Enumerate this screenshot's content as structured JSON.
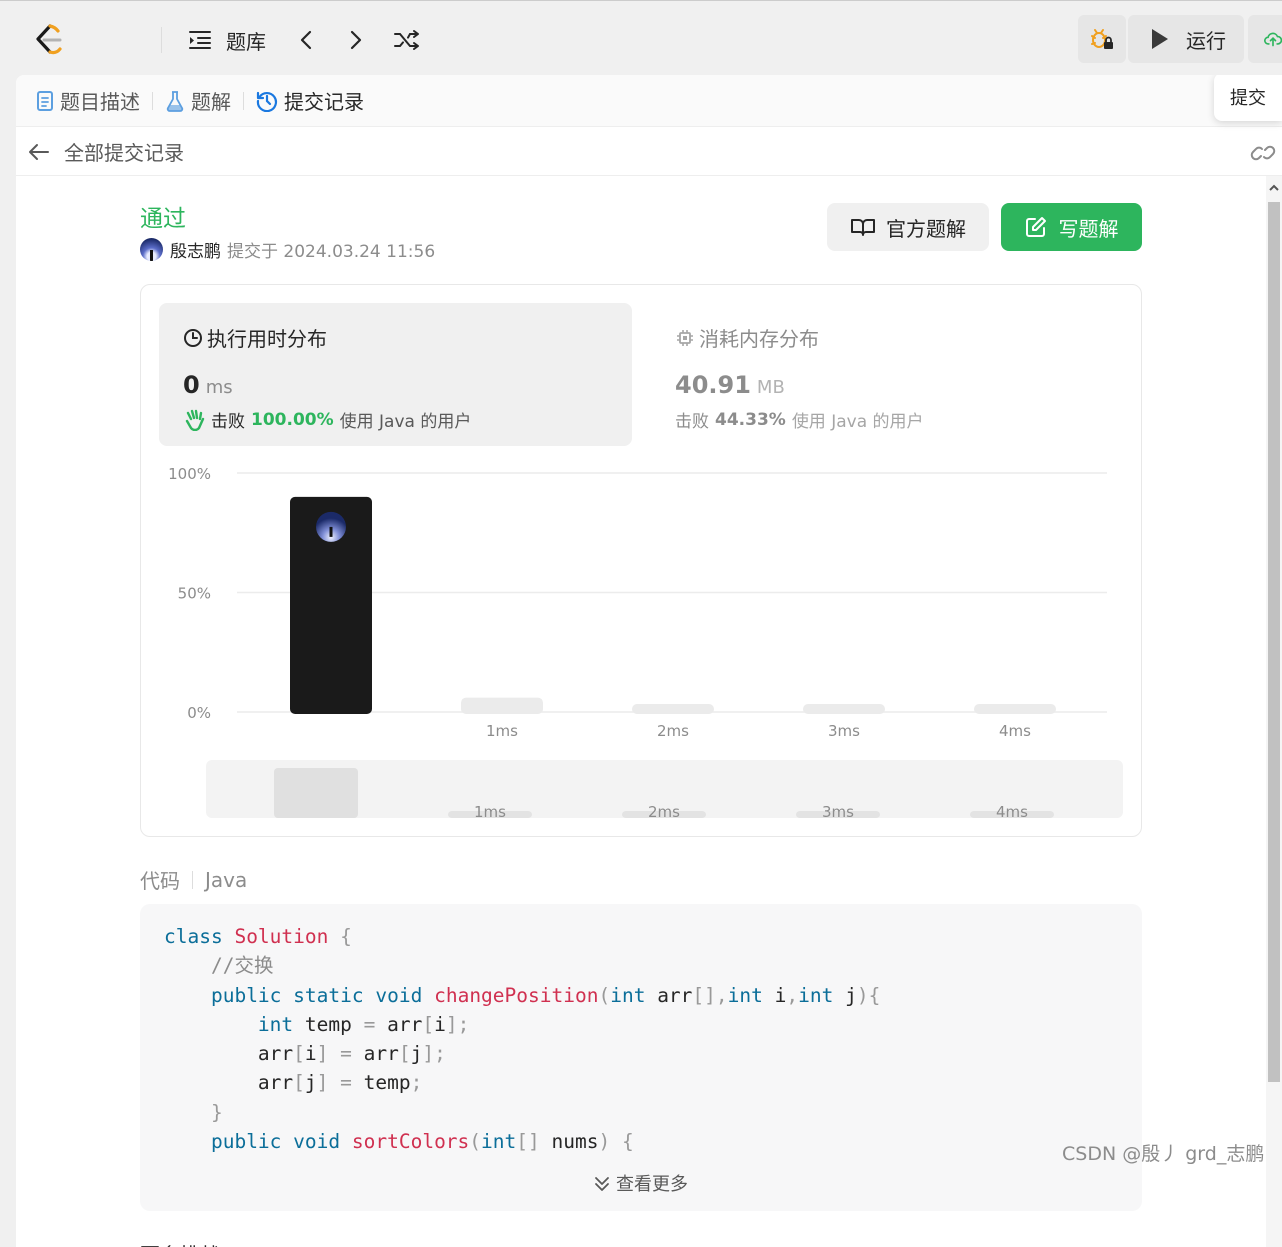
{
  "topbar": {
    "problem_bank_label": "题库",
    "run_label": "运行",
    "submit_label": "提交"
  },
  "tabs": [
    {
      "label": "题目描述",
      "icon": "document-icon",
      "color": "#5c9fe0"
    },
    {
      "label": "题解",
      "icon": "flask-icon",
      "color": "#5c9fe0"
    },
    {
      "label": "提交记录",
      "icon": "history-icon",
      "color": "#1a78e0"
    }
  ],
  "back": {
    "label": "全部提交记录"
  },
  "submission": {
    "status": "通过",
    "author": "殷志鹏",
    "submitted_at": "提交于 2024.03.24 11:56",
    "official_solution_label": "官方题解",
    "write_solution_label": "写题解"
  },
  "runtime": {
    "title": "执行用时分布",
    "value": "0",
    "unit": "ms",
    "beat_prefix": "击败",
    "beat_pct": "100.00%",
    "beat_suffix": "使用 Java 的用户"
  },
  "memory": {
    "title": "消耗内存分布",
    "value": "40.91",
    "unit": "MB",
    "beat_prefix": "击败",
    "beat_pct": "44.33%",
    "beat_suffix": "使用 Java 的用户"
  },
  "chart_data": {
    "type": "bar",
    "categories": [
      "0ms",
      "1ms",
      "2ms",
      "3ms",
      "4ms"
    ],
    "values": [
      90,
      6,
      2,
      2,
      2
    ],
    "tick_labels": [
      "",
      "1ms",
      "2ms",
      "3ms",
      "4ms"
    ],
    "highlight_index": 0,
    "ylim": [
      0,
      100
    ],
    "yticks": [
      "100%",
      "50%",
      "0%"
    ],
    "grid": true,
    "colors": {
      "highlight": "#1a1a1a",
      "bar": "#ebebeb",
      "grid": "#ececec"
    },
    "overview": {
      "values": [
        22,
        3,
        3,
        3,
        3
      ],
      "tick_labels": [
        "",
        "1ms",
        "2ms",
        "3ms",
        "4ms"
      ]
    }
  },
  "code": {
    "label": "代码",
    "language": "Java",
    "lines": [
      [
        {
          "c": "kw",
          "t": "class"
        },
        {
          "c": "",
          "t": " "
        },
        {
          "c": "fn",
          "t": "Solution"
        },
        {
          "c": "",
          "t": " "
        },
        {
          "c": "pu",
          "t": "{"
        }
      ],
      [
        {
          "c": "",
          "t": "    "
        },
        {
          "c": "cm",
          "t": "//交换"
        }
      ],
      [
        {
          "c": "",
          "t": "    "
        },
        {
          "c": "kw",
          "t": "public"
        },
        {
          "c": "",
          "t": " "
        },
        {
          "c": "kw",
          "t": "static"
        },
        {
          "c": "",
          "t": " "
        },
        {
          "c": "kw",
          "t": "void"
        },
        {
          "c": "",
          "t": " "
        },
        {
          "c": "fn",
          "t": "changePosition"
        },
        {
          "c": "pu",
          "t": "("
        },
        {
          "c": "ty",
          "t": "int"
        },
        {
          "c": "",
          "t": " arr"
        },
        {
          "c": "pu",
          "t": "[],"
        },
        {
          "c": "ty",
          "t": "int"
        },
        {
          "c": "",
          "t": " i"
        },
        {
          "c": "pu",
          "t": ","
        },
        {
          "c": "ty",
          "t": "int"
        },
        {
          "c": "",
          "t": " j"
        },
        {
          "c": "pu",
          "t": "){"
        }
      ],
      [
        {
          "c": "",
          "t": "        "
        },
        {
          "c": "ty",
          "t": "int"
        },
        {
          "c": "",
          "t": " temp "
        },
        {
          "c": "pu",
          "t": "="
        },
        {
          "c": "",
          "t": " arr"
        },
        {
          "c": "pu",
          "t": "["
        },
        {
          "c": "",
          "t": "i"
        },
        {
          "c": "pu",
          "t": "];"
        }
      ],
      [
        {
          "c": "",
          "t": "        arr"
        },
        {
          "c": "pu",
          "t": "["
        },
        {
          "c": "",
          "t": "i"
        },
        {
          "c": "pu",
          "t": "]"
        },
        {
          "c": "",
          "t": " "
        },
        {
          "c": "pu",
          "t": "="
        },
        {
          "c": "",
          "t": " arr"
        },
        {
          "c": "pu",
          "t": "["
        },
        {
          "c": "",
          "t": "j"
        },
        {
          "c": "pu",
          "t": "];"
        }
      ],
      [
        {
          "c": "",
          "t": "        arr"
        },
        {
          "c": "pu",
          "t": "["
        },
        {
          "c": "",
          "t": "j"
        },
        {
          "c": "pu",
          "t": "]"
        },
        {
          "c": "",
          "t": " "
        },
        {
          "c": "pu",
          "t": "="
        },
        {
          "c": "",
          "t": " temp"
        },
        {
          "c": "pu",
          "t": ";"
        }
      ],
      [
        {
          "c": "",
          "t": "    "
        },
        {
          "c": "pu",
          "t": "}"
        }
      ],
      [
        {
          "c": "",
          "t": "    "
        },
        {
          "c": "kw",
          "t": "public"
        },
        {
          "c": "",
          "t": " "
        },
        {
          "c": "kw",
          "t": "void"
        },
        {
          "c": "",
          "t": " "
        },
        {
          "c": "fn",
          "t": "sortColors"
        },
        {
          "c": "pu",
          "t": "("
        },
        {
          "c": "ty",
          "t": "int"
        },
        {
          "c": "pu",
          "t": "[]"
        },
        {
          "c": "",
          "t": " nums"
        },
        {
          "c": "pu",
          "t": ")"
        },
        {
          "c": "",
          "t": " "
        },
        {
          "c": "pu",
          "t": "{"
        }
      ]
    ],
    "view_more_label": "查看更多"
  },
  "next_section_title": "更多挑战",
  "watermark": "CSDN @殷丿 grd_志鹏"
}
